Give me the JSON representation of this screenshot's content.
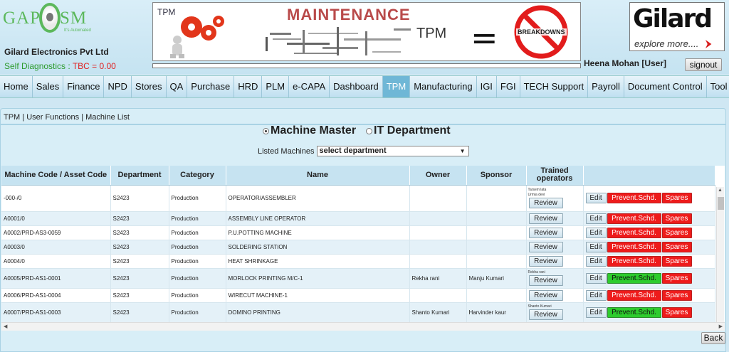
{
  "header": {
    "logo_left": "GAP",
    "logo_right": "SM",
    "logo_tagline": "It's Automated",
    "company": "Gilard Electronics Pvt Ltd",
    "self_diag_label": "Self Diagnostics : ",
    "self_diag_value": "TBC = 0.00",
    "banner": {
      "tpm_small": "TPM",
      "title": "MAINTENANCE",
      "tpm_big": "TPM",
      "equals": "=",
      "breakdowns": "BREAKDOWNS"
    },
    "brand": {
      "name": "Gilard",
      "tagline": "explore more...."
    },
    "user": "Heena Mohan [User]",
    "signout": "signout"
  },
  "nav": {
    "items": [
      "Home",
      "Sales",
      "Finance",
      "NPD",
      "Stores",
      "QA",
      "Purchase",
      "HRD",
      "PLM",
      "e-CAPA",
      "Dashboard",
      "TPM",
      "Manufacturing",
      "IGI",
      "FGI",
      "TECH Support",
      "Payroll",
      "Document Control",
      "Tool Room"
    ],
    "active": "TPM"
  },
  "page": {
    "breadcrumb": "TPM | User Functions | Machine List",
    "radio_machine_master": "Machine Master",
    "radio_it_department": "IT Department",
    "radio_selected": "Machine Master",
    "listed_label": "Listed Machines",
    "select_value": "select department",
    "back": "Back"
  },
  "table": {
    "headers": [
      "Machine Code / Asset Code",
      "Department",
      "Category",
      "Name",
      "Owner",
      "Sponsor",
      "Trained operators",
      ""
    ],
    "review_label": "Review",
    "edit_label": "Edit",
    "prevent_label": "Prevent.Schd.",
    "spares_label": "Spares",
    "rows": [
      {
        "code": "-000-/0",
        "dept": "S2423",
        "category": "Production",
        "name": "OPERATOR/ASSEMBLER",
        "owner": "",
        "sponsor": "",
        "trainers": [
          "Tarsem lata",
          "Urmia devi"
        ],
        "prevent_status": "red"
      },
      {
        "code": "A0001/0",
        "dept": "S2423",
        "category": "Production",
        "name": "ASSEMBLY LINE OPERATOR",
        "owner": "",
        "sponsor": "",
        "trainers": [],
        "prevent_status": "red"
      },
      {
        "code": "A0002/PRD-AS3-0059",
        "dept": "S2423",
        "category": "Production",
        "name": "P.U.POTTING MACHINE",
        "owner": "",
        "sponsor": "",
        "trainers": [],
        "prevent_status": "red"
      },
      {
        "code": "A0003/0",
        "dept": "S2423",
        "category": "Production",
        "name": "SOLDERING STATION",
        "owner": "",
        "sponsor": "",
        "trainers": [],
        "prevent_status": "red"
      },
      {
        "code": "A0004/0",
        "dept": "S2423",
        "category": "Production",
        "name": "HEAT SHRINKAGE",
        "owner": "",
        "sponsor": "",
        "trainers": [],
        "prevent_status": "red"
      },
      {
        "code": "A0005/PRD-AS1-0001",
        "dept": "S2423",
        "category": "Production",
        "name": "MORLOCK PRINTING M/C-1",
        "owner": "Rekha rani",
        "sponsor": "Manju Kumari",
        "trainers": [
          "Rekha rani"
        ],
        "prevent_status": "green"
      },
      {
        "code": "A0006/PRD-AS1-0004",
        "dept": "S2423",
        "category": "Production",
        "name": "WIRECUT MACHINE-1",
        "owner": "",
        "sponsor": "",
        "trainers": [],
        "prevent_status": "red"
      },
      {
        "code": "A0007/PRD-AS1-0003",
        "dept": "S2423",
        "category": "Production",
        "name": "DOMINO PRINTING",
        "owner": "Shanto Kumari",
        "sponsor": "Harvinder kaur",
        "trainers": [
          "Shanto Kumari"
        ],
        "prevent_status": "green"
      }
    ]
  },
  "colors": {
    "nav_active": "#6fb7d6",
    "prevent_red": "#ee1b1b",
    "prevent_green": "#2dcc2d",
    "spares": "#ee1b1b",
    "tbc": "#e02020"
  }
}
